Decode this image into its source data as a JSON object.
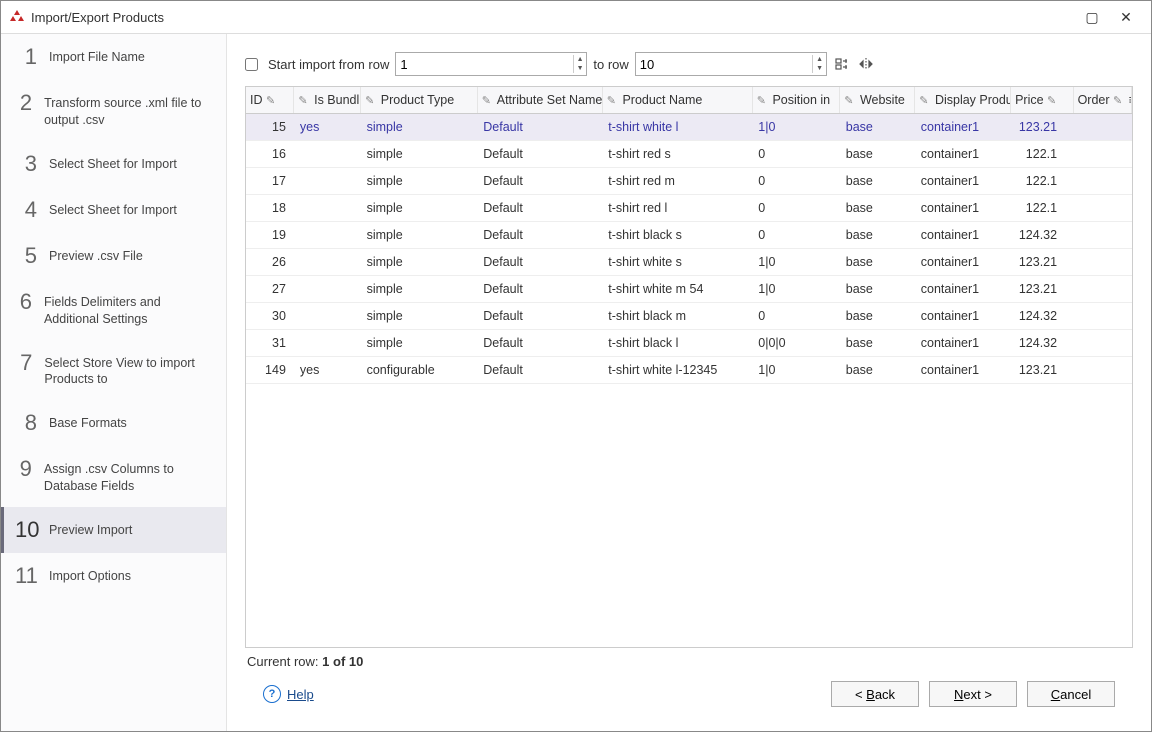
{
  "window": {
    "title": "Import/Export Products"
  },
  "sidebar": {
    "active_index": 9,
    "steps": [
      {
        "num": "1",
        "label": "Import File Name"
      },
      {
        "num": "2",
        "label": "Transform source .xml file to output .csv"
      },
      {
        "num": "3",
        "label": "Select Sheet for Import"
      },
      {
        "num": "4",
        "label": "Select Sheet for Import"
      },
      {
        "num": "5",
        "label": "Preview .csv File"
      },
      {
        "num": "6",
        "label": "Fields Delimiters and Additional Settings"
      },
      {
        "num": "7",
        "label": "Select Store View to import Products to"
      },
      {
        "num": "8",
        "label": "Base Formats"
      },
      {
        "num": "9",
        "label": "Assign .csv Columns to Database Fields"
      },
      {
        "num": "10",
        "label": "Preview Import"
      },
      {
        "num": "11",
        "label": "Import Options"
      }
    ]
  },
  "toolbar": {
    "start_import_label": "Start import from row",
    "start_row_value": "1",
    "to_row_label": "to row",
    "to_row_value": "10"
  },
  "table": {
    "columns": [
      {
        "key": "id",
        "label": "ID",
        "pencil_after": true
      },
      {
        "key": "is_bundle",
        "label": "Is Bundl",
        "pencil_before": true
      },
      {
        "key": "product_type",
        "label": "Product Type",
        "pencil_before": true
      },
      {
        "key": "attr_set",
        "label": "Attribute Set Name",
        "pencil_before": true
      },
      {
        "key": "product_name",
        "label": "Product Name",
        "pencil_before": true
      },
      {
        "key": "position",
        "label": "Position in",
        "pencil_before": true
      },
      {
        "key": "website",
        "label": "Website",
        "pencil_before": true
      },
      {
        "key": "display",
        "label": "Display Produ",
        "pencil_before": true
      },
      {
        "key": "price",
        "label": "Price",
        "pencil_after": true
      },
      {
        "key": "order",
        "label": "Order",
        "pencil_after": true
      }
    ],
    "rows": [
      {
        "id": "15",
        "is_bundle": "yes",
        "product_type": "simple",
        "attr_set": "Default",
        "product_name": "t-shirt  white l",
        "position": "1|0",
        "website": "base",
        "display": "container1",
        "price": "123.21",
        "selected": true
      },
      {
        "id": "16",
        "is_bundle": "",
        "product_type": "simple",
        "attr_set": "Default",
        "product_name": "t-shirt  red s",
        "position": "0",
        "website": "base",
        "display": "container1",
        "price": "122.1"
      },
      {
        "id": "17",
        "is_bundle": "",
        "product_type": "simple",
        "attr_set": "Default",
        "product_name": "t-shirt  red m",
        "position": "0",
        "website": "base",
        "display": "container1",
        "price": "122.1"
      },
      {
        "id": "18",
        "is_bundle": "",
        "product_type": "simple",
        "attr_set": "Default",
        "product_name": "t-shirt  red l",
        "position": "0",
        "website": "base",
        "display": "container1",
        "price": "122.1"
      },
      {
        "id": "19",
        "is_bundle": "",
        "product_type": "simple",
        "attr_set": "Default",
        "product_name": "t-shirt  black s",
        "position": "0",
        "website": "base",
        "display": "container1",
        "price": "124.32"
      },
      {
        "id": "26",
        "is_bundle": "",
        "product_type": "simple",
        "attr_set": "Default",
        "product_name": "t-shirt  white s",
        "position": "1|0",
        "website": "base",
        "display": "container1",
        "price": "123.21"
      },
      {
        "id": "27",
        "is_bundle": "",
        "product_type": "simple",
        "attr_set": "Default",
        "product_name": "t-shirt  white m 54",
        "position": "1|0",
        "website": "base",
        "display": "container1",
        "price": "123.21"
      },
      {
        "id": "30",
        "is_bundle": "",
        "product_type": "simple",
        "attr_set": "Default",
        "product_name": "t-shirt  black m",
        "position": "0",
        "website": "base",
        "display": "container1",
        "price": "124.32"
      },
      {
        "id": "31",
        "is_bundle": "",
        "product_type": "simple",
        "attr_set": "Default",
        "product_name": "t-shirt  black l",
        "position": "0|0|0",
        "website": "base",
        "display": "container1",
        "price": "124.32"
      },
      {
        "id": "149",
        "is_bundle": "yes",
        "product_type": "configurable",
        "attr_set": "Default",
        "product_name": "t-shirt  white l-12345",
        "position": "1|0",
        "website": "base",
        "display": "container1",
        "price": "123.21"
      }
    ]
  },
  "status": {
    "current_row_label": "Current row:",
    "current_row_value": "1 of 10"
  },
  "footer": {
    "help": "Help",
    "back": "< Back",
    "next": "Next >",
    "cancel": "Cancel"
  }
}
